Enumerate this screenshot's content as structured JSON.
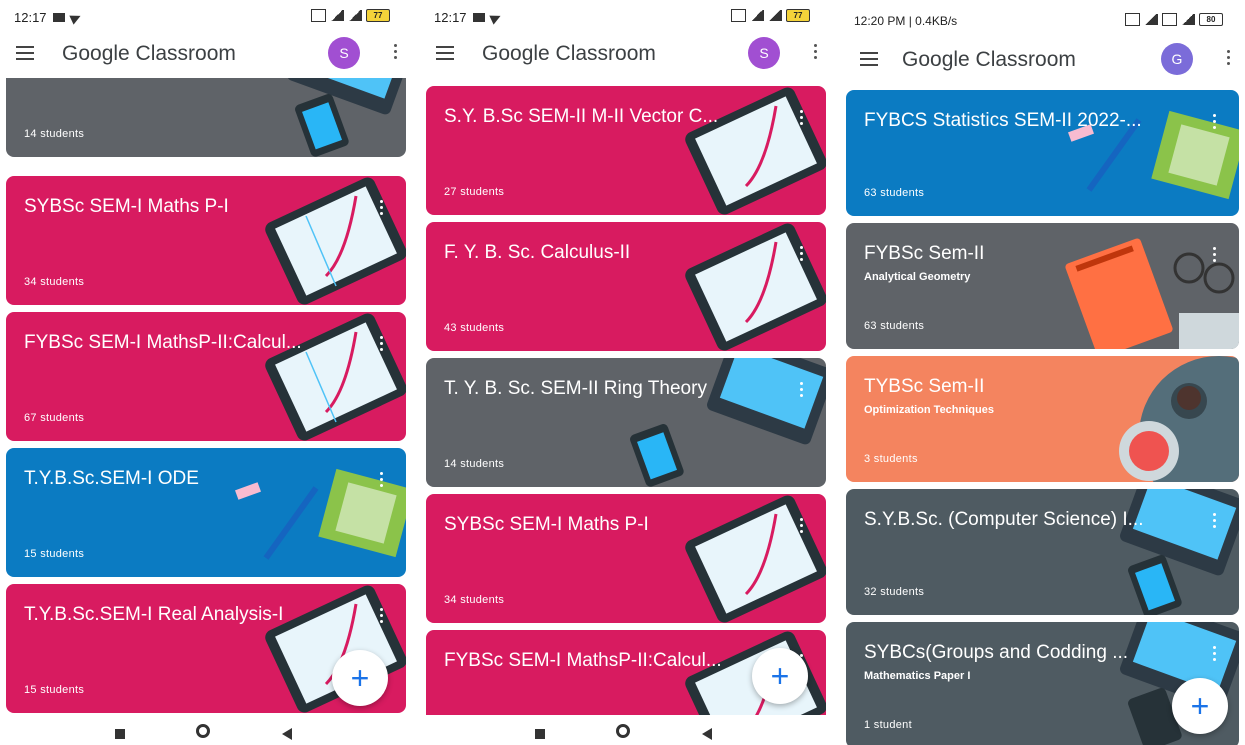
{
  "app_title": "Google Classroom",
  "screens": [
    {
      "status_time": "12:17",
      "battery": "77",
      "avatar_letter": "S",
      "avatar_color": "#a14fd2",
      "cards": [
        {
          "name": "",
          "subtitle": "",
          "students": "14 students",
          "color": "gray",
          "art": "laptop"
        },
        {
          "name": "SYBSc SEM-I Maths P-I",
          "subtitle": "",
          "students": "34 students",
          "color": "pink",
          "art": "tablet"
        },
        {
          "name": "FYBSc SEM-I MathsP-II:Calcul...",
          "subtitle": "",
          "students": "67 students",
          "color": "pink",
          "art": "tablet"
        },
        {
          "name": "T.Y.B.Sc.SEM-I ODE",
          "subtitle": "",
          "students": "15 students",
          "color": "blue",
          "art": "pen"
        },
        {
          "name": "T.Y.B.Sc.SEM-I Real Analysis-I",
          "subtitle": "",
          "students": "15 students",
          "color": "pink",
          "art": "tablet"
        }
      ]
    },
    {
      "status_time": "12:17",
      "battery": "77",
      "avatar_letter": "S",
      "avatar_color": "#a14fd2",
      "cards": [
        {
          "name": "S.Y. B.Sc SEM-II M-II Vector C...",
          "subtitle": "",
          "students": "27 students",
          "color": "pink",
          "art": "tablet"
        },
        {
          "name": "F. Y. B. Sc. Calculus-II",
          "subtitle": "",
          "students": "43 students",
          "color": "pink",
          "art": "tablet"
        },
        {
          "name": "T. Y. B. Sc. SEM-II Ring Theory",
          "subtitle": "",
          "students": "14 students",
          "color": "gray",
          "art": "laptop"
        },
        {
          "name": "SYBSc SEM-I Maths P-I",
          "subtitle": "",
          "students": "34 students",
          "color": "pink",
          "art": "tablet"
        },
        {
          "name": "FYBSc SEM-I MathsP-II:Calcul...",
          "subtitle": "",
          "students": "",
          "color": "pink",
          "art": "tablet"
        }
      ]
    },
    {
      "status_time": "12:20 PM | 0.4KB/s",
      "battery": "80",
      "avatar_letter": "G",
      "avatar_color": "#7b6cd9",
      "cards": [
        {
          "name": "FYBCS Statistics SEM-II 2022-...",
          "subtitle": "",
          "students": "63 students",
          "color": "blue",
          "art": "pen"
        },
        {
          "name": "FYBSc Sem-II",
          "subtitle": "Analytical Geometry",
          "students": "63 students",
          "color": "gray",
          "art": "book"
        },
        {
          "name": "TYBSc Sem-II",
          "subtitle": "Optimization Techniques",
          "students": "3 students",
          "color": "orange",
          "art": "coffee"
        },
        {
          "name": "S.Y.B.Sc. (Computer Science) I...",
          "subtitle": "",
          "students": "32 students",
          "color": "darkgray",
          "art": "laptop"
        },
        {
          "name": "SYBCs(Groups and Codding ...",
          "subtitle": "Mathematics Paper I",
          "students": "1 student",
          "color": "darkgray",
          "art": "laptop"
        }
      ]
    }
  ],
  "fab_symbol": "+"
}
